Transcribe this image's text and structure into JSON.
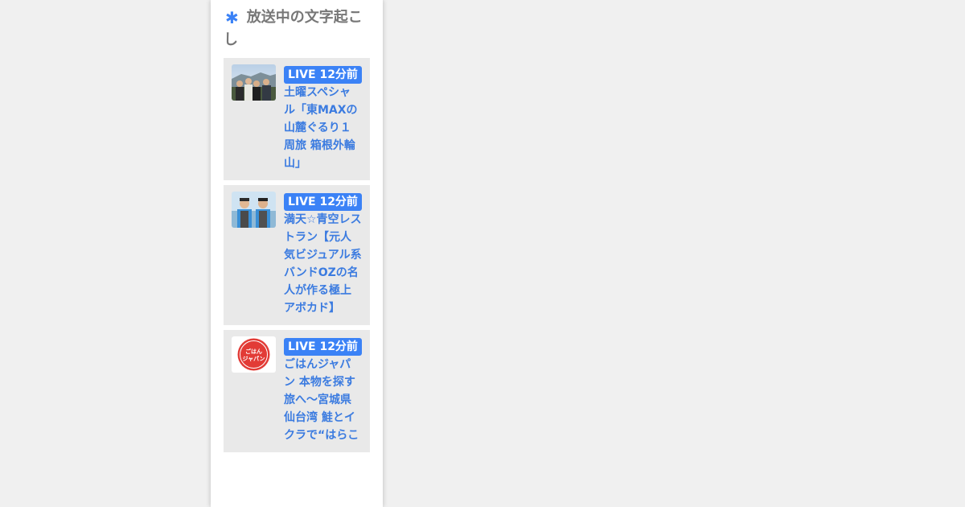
{
  "sidebar": {
    "heading": "放送中の文字起こし",
    "heading_icon": "asterisk-icon",
    "accent_color": "#3b82f6",
    "link_color": "#3b7be0",
    "items": [
      {
        "badge": "LIVE 12分前",
        "title": "土曜スペシャル「東MAXの山麓ぐるり１周旅 箱根外輪山」",
        "thumbnail": "group-outdoor-photo"
      },
      {
        "badge": "LIVE 12分前",
        "title": "満天☆青空レストラン【元人気ビジュアル系バンドOZの名人が作る極上アボカド】",
        "thumbnail": "two-men-photo"
      },
      {
        "badge": "LIVE 12分前",
        "title": "ごはんジャパン 本物を探す旅へ～宮城県仙台湾 鮭とイクラで“はらこ",
        "thumbnail": "gohan-japan-logo",
        "logo_text": "ごはんジャパン"
      }
    ]
  }
}
